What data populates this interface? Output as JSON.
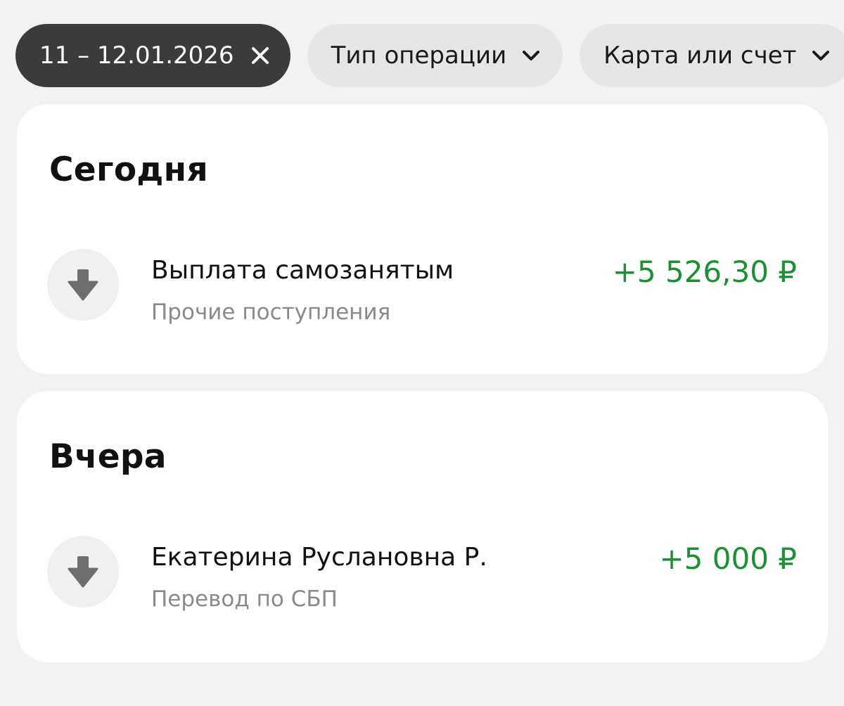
{
  "filters": {
    "date_range": {
      "label": "11 – 12.01.2026",
      "icon": "close-icon"
    },
    "operation_type": {
      "label": "Тип операции",
      "icon": "chevron-down-icon"
    },
    "card_or_account": {
      "label": "Карта или счет",
      "icon": "chevron-down-icon"
    }
  },
  "sections": [
    {
      "title": "Сегодня",
      "transactions": [
        {
          "title": "Выплата самозанятым",
          "subtitle": "Прочие поступления",
          "amount": "+5 526,30 ₽",
          "icon": "arrow-down-icon"
        }
      ]
    },
    {
      "title": "Вчера",
      "transactions": [
        {
          "title": "Екатерина Руслановна Р.",
          "subtitle": "Перевод по СБП",
          "amount": "+5 000 ₽",
          "icon": "arrow-down-icon"
        }
      ]
    }
  ],
  "colors": {
    "income": "#1f8f35",
    "chip_active": "#3b3b3b",
    "chip": "#e6e6e6",
    "background": "#f2f2f2"
  }
}
